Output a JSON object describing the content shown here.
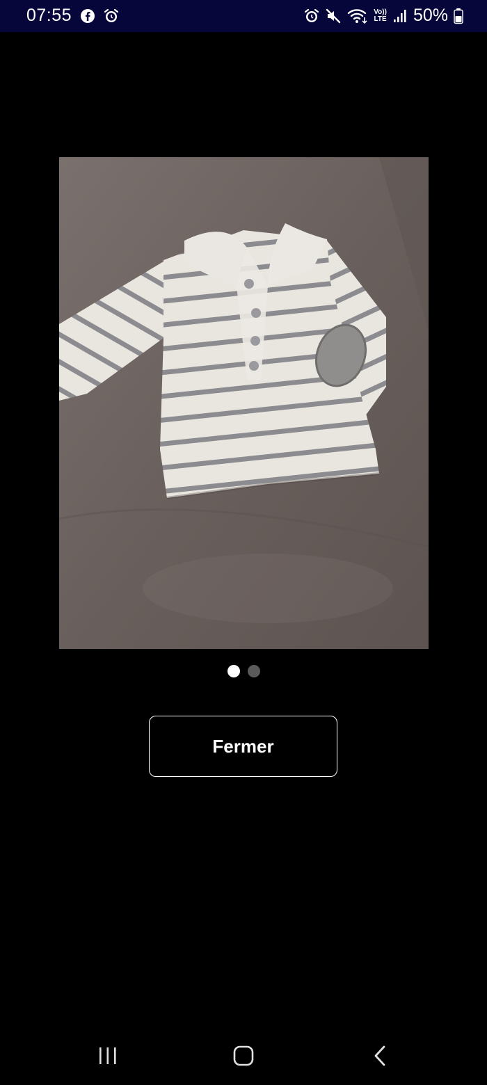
{
  "status_bar": {
    "time": "07:55",
    "left_icons": [
      "facebook-icon",
      "alarm-icon"
    ],
    "right_icons": [
      "alarm-icon",
      "mute-icon",
      "wifi-icon",
      "volte-icon",
      "signal-icon",
      "battery-icon"
    ],
    "volte_label_top": "Vo))",
    "volte_label_bottom": "LTE",
    "battery_percent": "50%",
    "background_color": "#06063a"
  },
  "viewer": {
    "photo": {
      "subject": "striped baby polo shirt",
      "background_color": "#6b625f"
    },
    "pager": {
      "count": 2,
      "active_index": 0
    },
    "close_label": "Fermer"
  },
  "nav_bar": {
    "buttons": [
      "recents-icon",
      "home-icon",
      "back-icon"
    ]
  }
}
